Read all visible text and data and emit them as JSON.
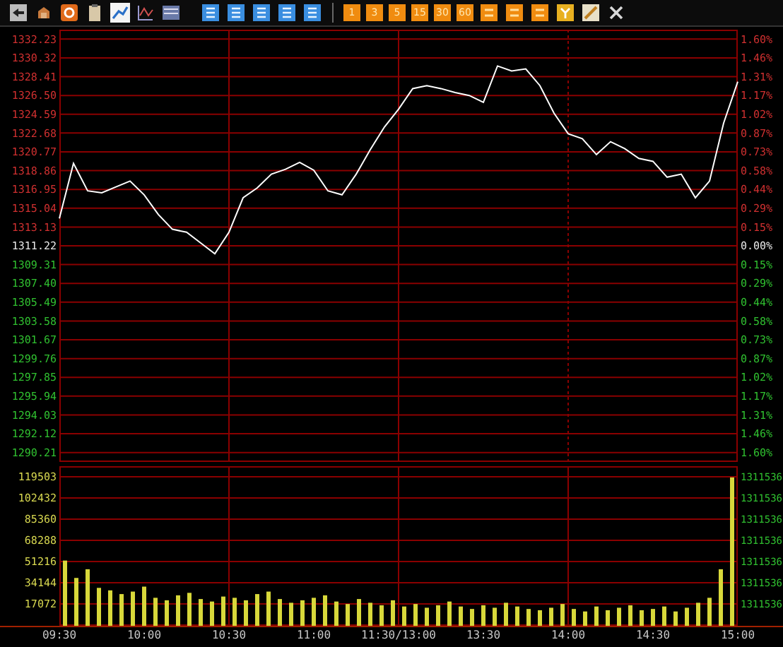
{
  "toolbar": {
    "tools": [
      {
        "selected": false
      },
      {
        "selected": false
      },
      {
        "selected": false
      },
      {
        "selected": false
      },
      {
        "selected": true
      },
      {
        "selected": false
      },
      {
        "selected": false
      }
    ],
    "period_buttons": [
      "1",
      "3",
      "5",
      "15",
      "30",
      "60"
    ]
  },
  "price_panel": {
    "chart_data": {
      "type": "line",
      "ylim": [
        1290.21,
        1332.23
      ],
      "grid": true,
      "yticks": [
        {
          "value": 1332.23,
          "label": "1332.23"
        },
        {
          "value": 1330.32,
          "label": "1330.32"
        },
        {
          "value": 1328.41,
          "label": "1328.41"
        },
        {
          "value": 1326.5,
          "label": "1326.50"
        },
        {
          "value": 1324.59,
          "label": "1324.59"
        },
        {
          "value": 1322.68,
          "label": "1322.68"
        },
        {
          "value": 1320.77,
          "label": "1320.77"
        },
        {
          "value": 1318.86,
          "label": "1318.86"
        },
        {
          "value": 1316.95,
          "label": "1316.95"
        },
        {
          "value": 1315.04,
          "label": "1315.04"
        },
        {
          "value": 1313.13,
          "label": "1313.13"
        },
        {
          "value": 1311.22,
          "label": "1311.22"
        },
        {
          "value": 1309.31,
          "label": "1309.31"
        },
        {
          "value": 1307.4,
          "label": "1307.40"
        },
        {
          "value": 1305.49,
          "label": "1305.49"
        },
        {
          "value": 1303.58,
          "label": "1303.58"
        },
        {
          "value": 1301.67,
          "label": "1301.67"
        },
        {
          "value": 1299.76,
          "label": "1299.76"
        },
        {
          "value": 1297.85,
          "label": "1297.85"
        },
        {
          "value": 1295.94,
          "label": "1295.94"
        },
        {
          "value": 1294.03,
          "label": "1294.03"
        },
        {
          "value": 1292.12,
          "label": "1292.12"
        },
        {
          "value": 1290.21,
          "label": "1290.21"
        }
      ],
      "series": [
        {
          "color": "#ffffff",
          "values": [
            1314,
            1319.6,
            1316.8,
            1316.6,
            1317.2,
            1317.8,
            1316.4,
            1314.4,
            1312.9,
            1312.6,
            1311.5,
            1310.4,
            1312.6,
            1316.1,
            1317.1,
            1318.5,
            1319,
            1319.7,
            1318.9,
            1316.8,
            1316.4,
            1318.5,
            1321,
            1323.3,
            1325.1,
            1327.2,
            1327.5,
            1327.2,
            1326.8,
            1326.5,
            1325.8,
            1329.5,
            1329,
            1329.2,
            1327.5,
            1324.7,
            1322.6,
            1322.1,
            1320.5,
            1321.8,
            1321.1,
            1320.1,
            1319.8,
            1318.2,
            1318.5,
            1316.1,
            1317.8,
            1323.7,
            1327.9
          ]
        }
      ]
    },
    "change_labels": [
      "1.60%",
      "1.46%",
      "1.31%",
      "1.17%",
      "1.02%",
      "0.87%",
      "0.73%",
      "0.58%",
      "0.44%",
      "0.29%",
      "0.15%",
      "0.00%",
      "0.15%",
      "0.29%",
      "0.44%",
      "0.58%",
      "0.73%",
      "0.87%",
      "1.02%",
      "1.17%",
      "1.31%",
      "1.46%",
      "1.60%"
    ]
  },
  "volume_panel": {
    "chart_data": {
      "type": "bar",
      "ylim": [
        0,
        119503
      ],
      "grid": true,
      "yticks": [
        {
          "value": 119503,
          "label": "119503"
        },
        {
          "value": 102432,
          "label": "102432"
        },
        {
          "value": 85360,
          "label": "85360"
        },
        {
          "value": 68288,
          "label": "68288"
        },
        {
          "value": 51216,
          "label": "51216"
        },
        {
          "value": 34144,
          "label": "34144"
        },
        {
          "value": 17072,
          "label": "17072"
        }
      ],
      "series": [
        {
          "color": "#d8d83a",
          "values": [
            52000,
            38000,
            45000,
            30000,
            28000,
            25000,
            27000,
            31000,
            22000,
            20000,
            24000,
            26000,
            21000,
            19000,
            23000,
            22000,
            20000,
            25000,
            27000,
            21000,
            18000,
            20000,
            22000,
            24000,
            19000,
            17000,
            21000,
            18000,
            16000,
            20000,
            15000,
            17000,
            14000,
            16000,
            19000,
            15000,
            13000,
            16000,
            14000,
            18000,
            15000,
            13000,
            12000,
            14000,
            17000,
            13000,
            11000,
            15000,
            12000,
            14000,
            16000,
            12000,
            13000,
            15000,
            11000,
            14000,
            18000,
            22000,
            45000,
            119000
          ]
        }
      ]
    },
    "right_labels": [
      "1311536",
      "1311536",
      "1311536",
      "1311536",
      "1311536",
      "1311536",
      "1311536"
    ]
  },
  "time_axis": [
    "09:30",
    "10:00",
    "10:30",
    "11:00",
    "11:30/13:00",
    "13:30",
    "14:00",
    "14:30",
    "15:00"
  ]
}
